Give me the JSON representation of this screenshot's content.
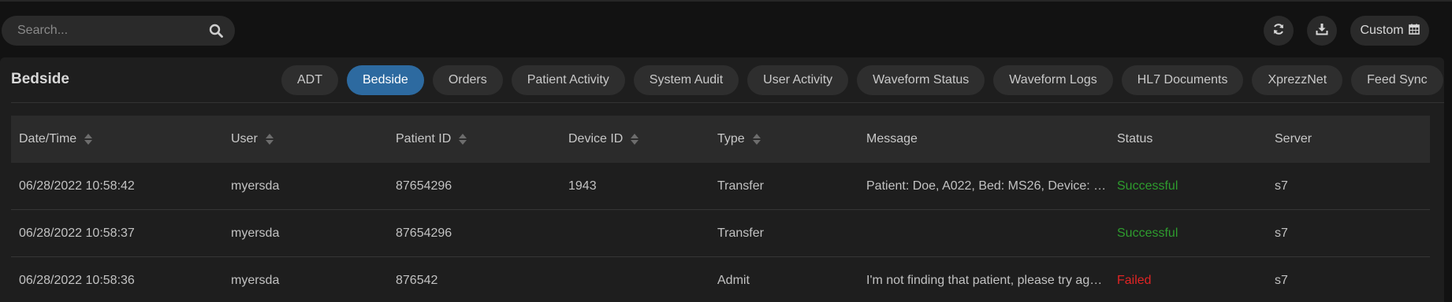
{
  "search": {
    "placeholder": "Search...",
    "icon": "search-icon"
  },
  "toolbar": {
    "refresh_icon": "refresh-icon",
    "download_icon": "download-icon",
    "custom_label": "Custom",
    "custom_icon": "calendar-icon"
  },
  "panel": {
    "title": "Bedside"
  },
  "tabs": [
    {
      "label": "ADT",
      "active": false
    },
    {
      "label": "Bedside",
      "active": true
    },
    {
      "label": "Orders",
      "active": false
    },
    {
      "label": "Patient Activity",
      "active": false
    },
    {
      "label": "System Audit",
      "active": false
    },
    {
      "label": "User Activity",
      "active": false
    },
    {
      "label": "Waveform Status",
      "active": false
    },
    {
      "label": "Waveform Logs",
      "active": false
    },
    {
      "label": "HL7 Documents",
      "active": false
    },
    {
      "label": "XprezzNet",
      "active": false
    },
    {
      "label": "Feed Sync",
      "active": false
    }
  ],
  "table": {
    "columns": [
      {
        "label": "Date/Time",
        "sortable": true
      },
      {
        "label": "User",
        "sortable": true
      },
      {
        "label": "Patient ID",
        "sortable": true
      },
      {
        "label": "Device ID",
        "sortable": true
      },
      {
        "label": "Type",
        "sortable": true
      },
      {
        "label": "Message",
        "sortable": false
      },
      {
        "label": "Status",
        "sortable": false
      },
      {
        "label": "Server",
        "sortable": false
      }
    ],
    "rows": [
      [
        "06/28/2022 10:58:42",
        "myersda",
        "87654296",
        "1943",
        "Transfer",
        "Patient: Doe, A022, Bed: MS26, Device: M…",
        "Successful",
        "s7"
      ],
      [
        "06/28/2022 10:58:37",
        "myersda",
        "87654296",
        "",
        "Transfer",
        "",
        "Successful",
        "s7"
      ],
      [
        "06/28/2022 10:58:36",
        "myersda",
        "876542",
        "",
        "Admit",
        "I'm not finding that patient, please try ag…",
        "Failed",
        "s7"
      ]
    ]
  },
  "colors": {
    "accent": "#2d6aa0",
    "success": "#2e9c2e",
    "failed": "#e02424",
    "background": "#121212",
    "panel": "#1e1e1e"
  }
}
